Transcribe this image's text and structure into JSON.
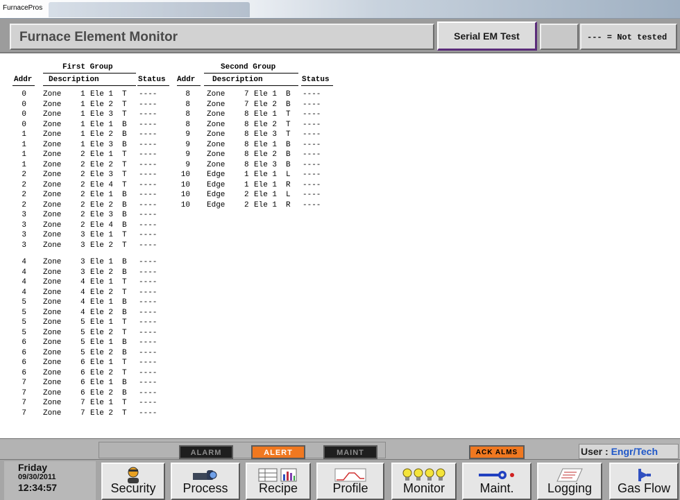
{
  "window": {
    "title": "FurnacePros"
  },
  "header": {
    "title": "Furnace Element Monitor",
    "test_button": "Serial EM Test",
    "legend": "--- = Not tested"
  },
  "groups": [
    {
      "title": "First Group",
      "headers": {
        "addr": "Addr",
        "desc": "Description",
        "status": "Status"
      },
      "rows": [
        {
          "addr": "0",
          "type": "Zone",
          "num": "1",
          "ele": "Ele 1",
          "pos": "T",
          "status": "----"
        },
        {
          "addr": "0",
          "type": "Zone",
          "num": "1",
          "ele": "Ele 2",
          "pos": "T",
          "status": "----"
        },
        {
          "addr": "0",
          "type": "Zone",
          "num": "1",
          "ele": "Ele 3",
          "pos": "T",
          "status": "----"
        },
        {
          "addr": "0",
          "type": "Zone",
          "num": "1",
          "ele": "Ele 1",
          "pos": "B",
          "status": "----"
        },
        {
          "addr": "1",
          "type": "Zone",
          "num": "1",
          "ele": "Ele 2",
          "pos": "B",
          "status": "----"
        },
        {
          "addr": "1",
          "type": "Zone",
          "num": "1",
          "ele": "Ele 3",
          "pos": "B",
          "status": "----"
        },
        {
          "addr": "1",
          "type": "Zone",
          "num": "2",
          "ele": "Ele 1",
          "pos": "T",
          "status": "----"
        },
        {
          "addr": "1",
          "type": "Zone",
          "num": "2",
          "ele": "Ele 2",
          "pos": "T",
          "status": "----"
        },
        {
          "addr": "2",
          "type": "Zone",
          "num": "2",
          "ele": "Ele 3",
          "pos": "T",
          "status": "----"
        },
        {
          "addr": "2",
          "type": "Zone",
          "num": "2",
          "ele": "Ele 4",
          "pos": "T",
          "status": "----"
        },
        {
          "addr": "2",
          "type": "Zone",
          "num": "2",
          "ele": "Ele 1",
          "pos": "B",
          "status": "----"
        },
        {
          "addr": "2",
          "type": "Zone",
          "num": "2",
          "ele": "Ele 2",
          "pos": "B",
          "status": "----"
        },
        {
          "addr": "3",
          "type": "Zone",
          "num": "2",
          "ele": "Ele 3",
          "pos": "B",
          "status": "----"
        },
        {
          "addr": "3",
          "type": "Zone",
          "num": "2",
          "ele": "Ele 4",
          "pos": "B",
          "status": "----"
        },
        {
          "addr": "3",
          "type": "Zone",
          "num": "3",
          "ele": "Ele 1",
          "pos": "T",
          "status": "----"
        },
        {
          "addr": "3",
          "type": "Zone",
          "num": "3",
          "ele": "Ele 2",
          "pos": "T",
          "status": "----"
        },
        {
          "addr": "4",
          "type": "Zone",
          "num": "3",
          "ele": "Ele 1",
          "pos": "B",
          "status": "----"
        },
        {
          "addr": "4",
          "type": "Zone",
          "num": "3",
          "ele": "Ele 2",
          "pos": "B",
          "status": "----"
        },
        {
          "addr": "4",
          "type": "Zone",
          "num": "4",
          "ele": "Ele 1",
          "pos": "T",
          "status": "----"
        },
        {
          "addr": "4",
          "type": "Zone",
          "num": "4",
          "ele": "Ele 2",
          "pos": "T",
          "status": "----"
        },
        {
          "addr": "5",
          "type": "Zone",
          "num": "4",
          "ele": "Ele 1",
          "pos": "B",
          "status": "----"
        },
        {
          "addr": "5",
          "type": "Zone",
          "num": "4",
          "ele": "Ele 2",
          "pos": "B",
          "status": "----"
        },
        {
          "addr": "5",
          "type": "Zone",
          "num": "5",
          "ele": "Ele 1",
          "pos": "T",
          "status": "----"
        },
        {
          "addr": "5",
          "type": "Zone",
          "num": "5",
          "ele": "Ele 2",
          "pos": "T",
          "status": "----"
        },
        {
          "addr": "6",
          "type": "Zone",
          "num": "5",
          "ele": "Ele 1",
          "pos": "B",
          "status": "----"
        },
        {
          "addr": "6",
          "type": "Zone",
          "num": "5",
          "ele": "Ele 2",
          "pos": "B",
          "status": "----"
        },
        {
          "addr": "6",
          "type": "Zone",
          "num": "6",
          "ele": "Ele 1",
          "pos": "T",
          "status": "----"
        },
        {
          "addr": "6",
          "type": "Zone",
          "num": "6",
          "ele": "Ele 2",
          "pos": "T",
          "status": "----"
        },
        {
          "addr": "7",
          "type": "Zone",
          "num": "6",
          "ele": "Ele 1",
          "pos": "B",
          "status": "----"
        },
        {
          "addr": "7",
          "type": "Zone",
          "num": "6",
          "ele": "Ele 2",
          "pos": "B",
          "status": "----"
        },
        {
          "addr": "7",
          "type": "Zone",
          "num": "7",
          "ele": "Ele 1",
          "pos": "T",
          "status": "----"
        },
        {
          "addr": "7",
          "type": "Zone",
          "num": "7",
          "ele": "Ele 2",
          "pos": "T",
          "status": "----"
        }
      ]
    },
    {
      "title": "Second  Group",
      "headers": {
        "addr": "Addr",
        "desc": "Description",
        "status": "Status"
      },
      "rows": [
        {
          "addr": "8",
          "type": "Zone",
          "num": "7",
          "ele": "Ele 1",
          "pos": "B",
          "status": "----"
        },
        {
          "addr": "8",
          "type": "Zone",
          "num": "7",
          "ele": "Ele 2",
          "pos": "B",
          "status": "----"
        },
        {
          "addr": "8",
          "type": "Zone",
          "num": "8",
          "ele": "Ele 1",
          "pos": "T",
          "status": "----"
        },
        {
          "addr": "8",
          "type": "Zone",
          "num": "8",
          "ele": "Ele 2",
          "pos": "T",
          "status": "----"
        },
        {
          "addr": "9",
          "type": "Zone",
          "num": "8",
          "ele": "Ele 3",
          "pos": "T",
          "status": "----"
        },
        {
          "addr": "9",
          "type": "Zone",
          "num": "8",
          "ele": "Ele 1",
          "pos": "B",
          "status": "----"
        },
        {
          "addr": "9",
          "type": "Zone",
          "num": "8",
          "ele": "Ele 2",
          "pos": "B",
          "status": "----"
        },
        {
          "addr": "9",
          "type": "Zone",
          "num": "8",
          "ele": "Ele 3",
          "pos": "B",
          "status": "----"
        },
        {
          "addr": "10",
          "type": "Edge",
          "num": "1",
          "ele": "Ele 1",
          "pos": "L",
          "status": "----"
        },
        {
          "addr": "10",
          "type": "Edge",
          "num": "1",
          "ele": "Ele 1",
          "pos": "R",
          "status": "----"
        },
        {
          "addr": "10",
          "type": "Edge",
          "num": "2",
          "ele": "Ele 1",
          "pos": "L",
          "status": "----"
        },
        {
          "addr": "10",
          "type": "Edge",
          "num": "2",
          "ele": "Ele 1",
          "pos": "R",
          "status": "----"
        }
      ]
    }
  ],
  "status_bar": {
    "alarm": "ALARM",
    "alert": "ALERT",
    "maint": "MAINT",
    "ack": "ACK ALMS",
    "user_label": "User :",
    "user_value": "Engr/Tech"
  },
  "datetime": {
    "day": "Friday",
    "date": "09/30/2011",
    "time": "12:34:57"
  },
  "nav": [
    {
      "label": "Security",
      "icon": "security-person-icon"
    },
    {
      "label": "Process",
      "icon": "process-camera-icon"
    },
    {
      "label": "Recipe",
      "icon": "recipe-chart-icon"
    },
    {
      "label": "Profile",
      "icon": "profile-graph-icon"
    },
    {
      "label": "Monitor",
      "icon": "monitor-bulbs-icon"
    },
    {
      "label": "Maint.",
      "icon": "maint-wrench-icon"
    },
    {
      "label": "Logging",
      "icon": "logging-notebook-icon"
    },
    {
      "label": "Gas Flow",
      "icon": "gasflow-valve-icon"
    }
  ]
}
